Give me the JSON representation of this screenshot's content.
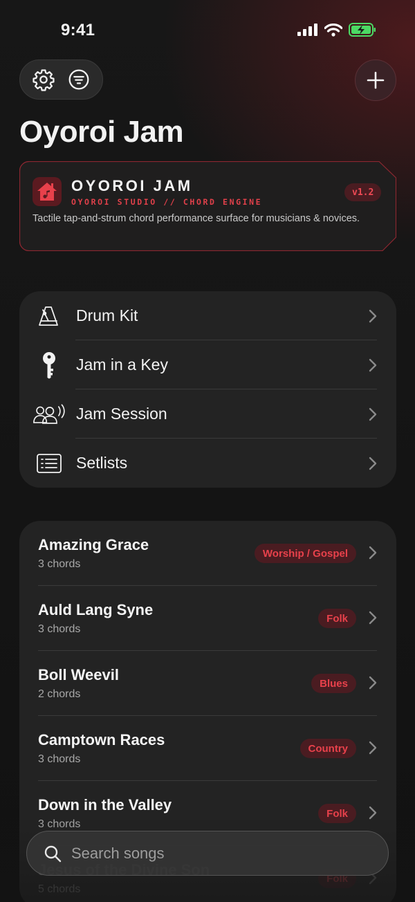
{
  "status": {
    "time": "9:41"
  },
  "page": {
    "title": "Oyoroi Jam"
  },
  "hero": {
    "title": "OYOROI JAM",
    "subtitle": "OYOROI STUDIO // CHORD ENGINE",
    "version": "v1.2",
    "description": "Tactile tap-and-strum chord performance surface for musicians & novices."
  },
  "menu": [
    {
      "label": "Drum Kit",
      "icon": "metronome-icon"
    },
    {
      "label": "Jam in a Key",
      "icon": "key-icon"
    },
    {
      "label": "Jam Session",
      "icon": "group-audio-icon"
    },
    {
      "label": "Setlists",
      "icon": "list-icon"
    }
  ],
  "songs": [
    {
      "name": "Amazing Grace",
      "meta": "3 chords",
      "genre": "Worship / Gospel"
    },
    {
      "name": "Auld Lang Syne",
      "meta": "3 chords",
      "genre": "Folk"
    },
    {
      "name": "Boll Weevil",
      "meta": "2 chords",
      "genre": "Blues"
    },
    {
      "name": "Camptown Races",
      "meta": "3 chords",
      "genre": "Country"
    },
    {
      "name": "Down in the Valley",
      "meta": "3 chords",
      "genre": "Folk"
    },
    {
      "name": "Jesus of the Divine Son",
      "meta": "5 chords",
      "genre": "Folk"
    }
  ],
  "search": {
    "placeholder": "Search songs"
  },
  "colors": {
    "accent": "#e8414b",
    "badge_bg": "#4a1c21",
    "card": "#232323"
  }
}
